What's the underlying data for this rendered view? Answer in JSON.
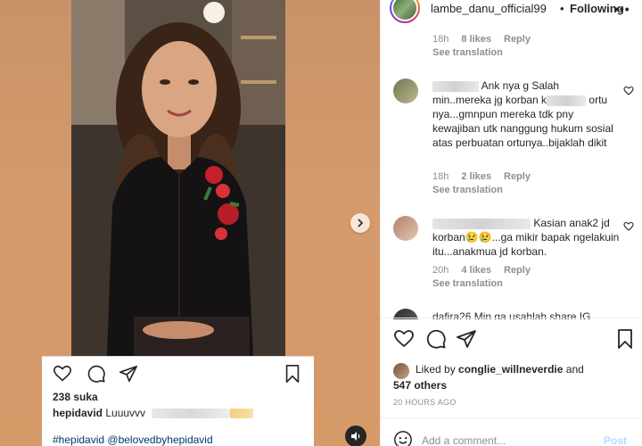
{
  "header": {
    "username": "lambe_danu_official99",
    "separator": "•",
    "follow_label": "Following",
    "more_label": "•••"
  },
  "comments": [
    {
      "time": "18h",
      "likes": "8 likes",
      "reply": "Reply",
      "see_translation": "See translation"
    },
    {
      "text_part1": "Ank nya g Salah min..mereka jg korban k",
      "text_part2": "ortu nya...gmnpun mereka tdk pny kewajiban utk nanggung hukum sosial atas perbuatan ortunya..bijaklah dikit",
      "time": "18h",
      "likes": "2 likes",
      "reply": "Reply",
      "see_translation": "See translation"
    },
    {
      "text_part1": "Kasian anak2 jd korban",
      "text_emoji": "😢😢",
      "text_part2": "...ga mikir bapak ngelakuin itu...anakmua jd korban.",
      "time": "20h",
      "likes": "4 likes",
      "reply": "Reply",
      "see_translation": "See translation"
    },
    {
      "text_partial": "dafira26 Min ga usahlah share IG"
    }
  ],
  "post_actions": {
    "like_icon": "heart-icon",
    "comment_icon": "comment-icon",
    "share_icon": "send-icon",
    "save_icon": "bookmark-icon"
  },
  "liked_by": {
    "prefix": "Liked by",
    "user": "conglie_willneverdie",
    "suffix": "and",
    "others": "547 others"
  },
  "time_ago": "20 HOURS AGO",
  "comment_box": {
    "placeholder": "Add a comment...",
    "post_label": "Post",
    "emoji_icon": "smiley-icon"
  },
  "inner_post": {
    "likes": "238 suka",
    "caption_user": "hepidavid",
    "caption_text": "Luuuvvv",
    "tags": "#hepidavid @belovedbyhepidavid"
  },
  "media": {
    "next_icon": "chevron-right-icon",
    "sound_icon": "speaker-icon"
  },
  "colors": {
    "text": "#262626",
    "muted": "#8e8e8e",
    "link": "#00376b",
    "post_disabled": "#b3dbff",
    "background_tan": "#d59a6c"
  }
}
